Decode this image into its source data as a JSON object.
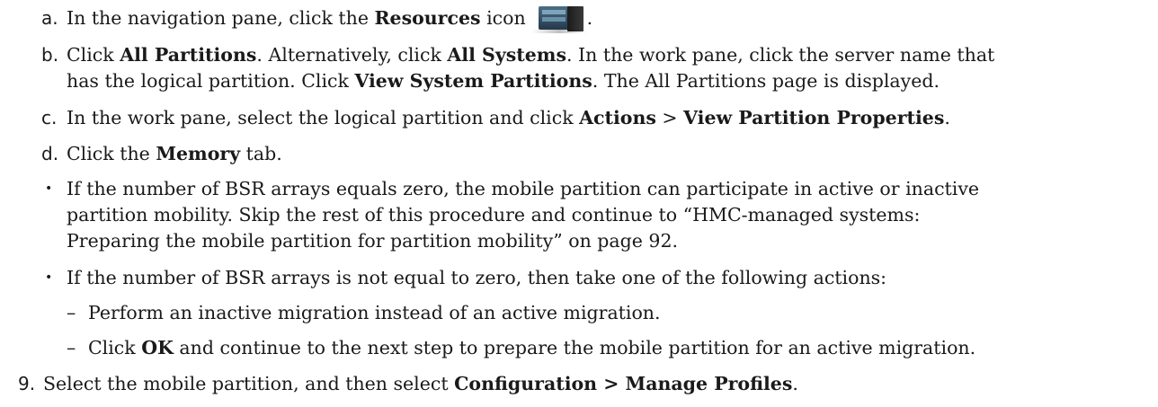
{
  "steps": {
    "a": {
      "marker": "a.",
      "pre": "In the navigation pane, click the ",
      "bold1": "Resources",
      "post": " icon",
      "icon": "resources-server-icon",
      "tail": "."
    },
    "b": {
      "marker": "b.",
      "p1": "Click ",
      "bold1": "All Partitions",
      "p2": ". Alternatively, click ",
      "bold2": "All Systems",
      "p3": ". In the work pane, click the server name that",
      "l2p1": "has the logical partition. Click ",
      "l2bold": "View System Partitions",
      "l2p2": ". The All Partitions page is displayed."
    },
    "c": {
      "marker": "c.",
      "p1": "In the work pane, select the logical partition and click ",
      "bold1": "Actions",
      "p2": " > ",
      "bold2": "View Partition Properties",
      "p3": "."
    },
    "d": {
      "marker": "d.",
      "p1": "Click the ",
      "bold1": "Memory",
      "p2": " tab."
    }
  },
  "bullets": {
    "first": {
      "symbol": "•",
      "l1": "If the number of BSR arrays equals zero, the mobile partition can participate in active or inactive",
      "l2": "partition mobility. Skip the rest of this procedure and continue to “HMC-managed systems:",
      "l3": "Preparing the mobile partition for partition mobility” on page 92."
    },
    "second": {
      "symbol": "•",
      "l1": "If the number of BSR arrays is not equal to zero, then take one of the following actions:",
      "sub1": {
        "dash": "–",
        "text": "Perform an inactive migration instead of an active migration."
      },
      "sub2": {
        "dash": "–",
        "p1": "Click ",
        "bold1": "OK",
        "p2": " and continue to the next step to prepare the mobile partition for an active migration."
      }
    }
  },
  "step9": {
    "marker": "9.",
    "p1": "Select the mobile partition, and then select ",
    "bold1": "Configuration > Manage Profiles",
    "p2": "."
  }
}
